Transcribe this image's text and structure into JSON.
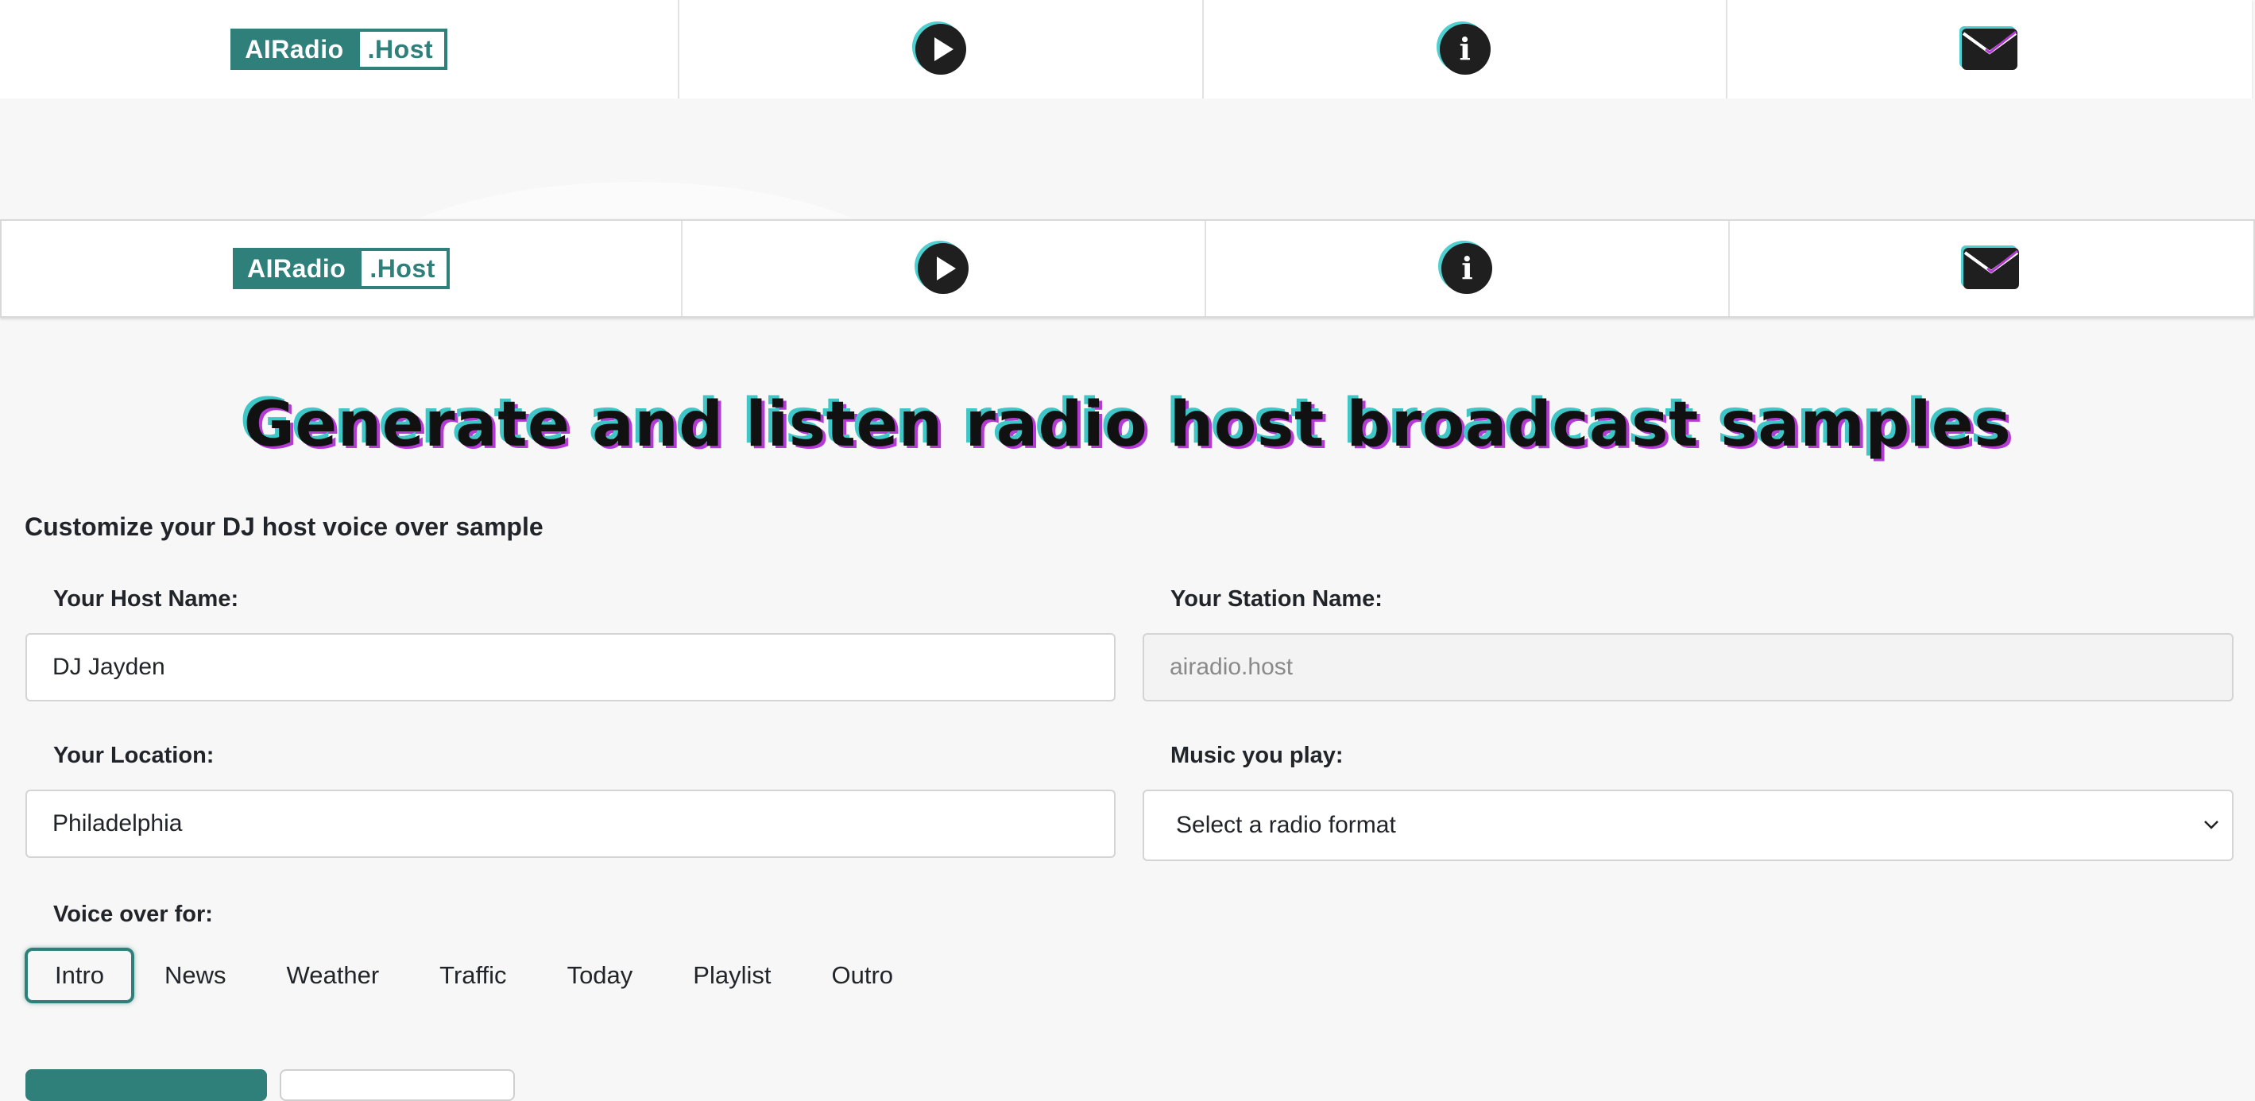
{
  "brand": {
    "part1": "AIRadio",
    "part2": ".Host"
  },
  "nav": {
    "icons": [
      "play-icon",
      "info-icon",
      "mail-icon"
    ]
  },
  "colors": {
    "accent": "#2f7f7a",
    "shadow_cyan": "#4ed0d0",
    "shadow_magenta": "#b43ad4"
  },
  "headline": "Generate and listen radio host broadcast samples",
  "form": {
    "section_title": "Customize your DJ host voice over sample",
    "host_name": {
      "label": "Your Host Name:",
      "value": "DJ Jayden"
    },
    "station_name": {
      "label": "Your Station Name:",
      "value": "airadio.host"
    },
    "location": {
      "label": "Your Location:",
      "value": "Philadelphia"
    },
    "music": {
      "label": "Music you play:",
      "value": "Select a radio format"
    },
    "voice_over": {
      "label": "Voice over for:",
      "tabs": [
        "Intro",
        "News",
        "Weather",
        "Traffic",
        "Today",
        "Playlist",
        "Outro"
      ],
      "active": "Intro"
    }
  }
}
